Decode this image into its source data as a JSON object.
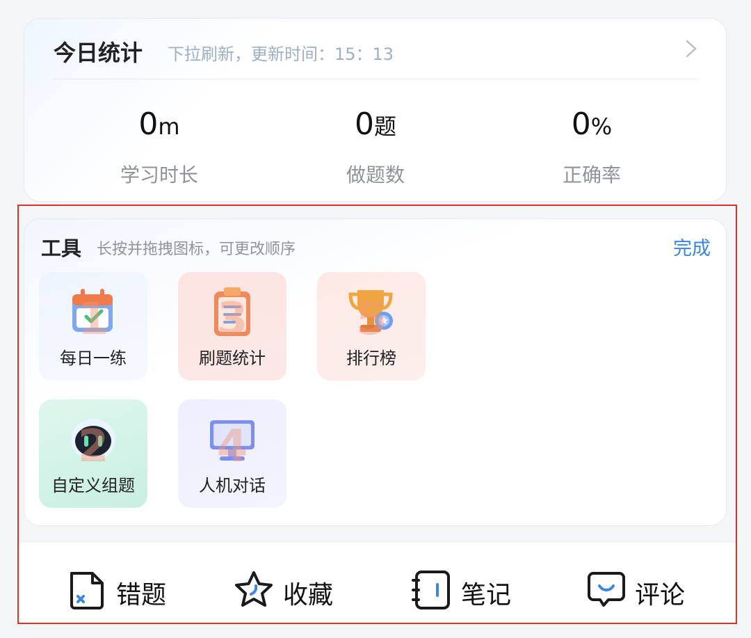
{
  "stats": {
    "title": "今日统计",
    "subtitle": "下拉刷新，更新时间：15：13",
    "items": [
      {
        "value": "0",
        "unit": "m",
        "label": "学习时长"
      },
      {
        "value": "0",
        "unit": "题",
        "label": "做题数"
      },
      {
        "value": "0",
        "unit": "%",
        "label": "正确率"
      }
    ]
  },
  "tools": {
    "title": "工具",
    "subtitle": "长按并拖拽图标，可更改顺序",
    "done_label": "完成",
    "items": [
      {
        "label": "每日一练",
        "number": "1",
        "icon": "calendar-icon"
      },
      {
        "label": "刷题统计",
        "number": "3",
        "icon": "clipboard-icon"
      },
      {
        "label": "排行榜",
        "number": "5",
        "icon": "trophy-icon"
      },
      {
        "label": "自定义组题",
        "number": "2",
        "icon": "robot-icon"
      },
      {
        "label": "人机对话",
        "number": "4",
        "icon": "monitor-icon"
      }
    ]
  },
  "bottom_bar": {
    "items": [
      {
        "label": "错题",
        "icon": "wrong-file-icon"
      },
      {
        "label": "收藏",
        "icon": "star-icon"
      },
      {
        "label": "笔记",
        "icon": "notebook-icon"
      },
      {
        "label": "评论",
        "icon": "comment-icon"
      }
    ]
  },
  "colors": {
    "accent": "#3a86e0",
    "highlight_frame": "#e0302a"
  }
}
